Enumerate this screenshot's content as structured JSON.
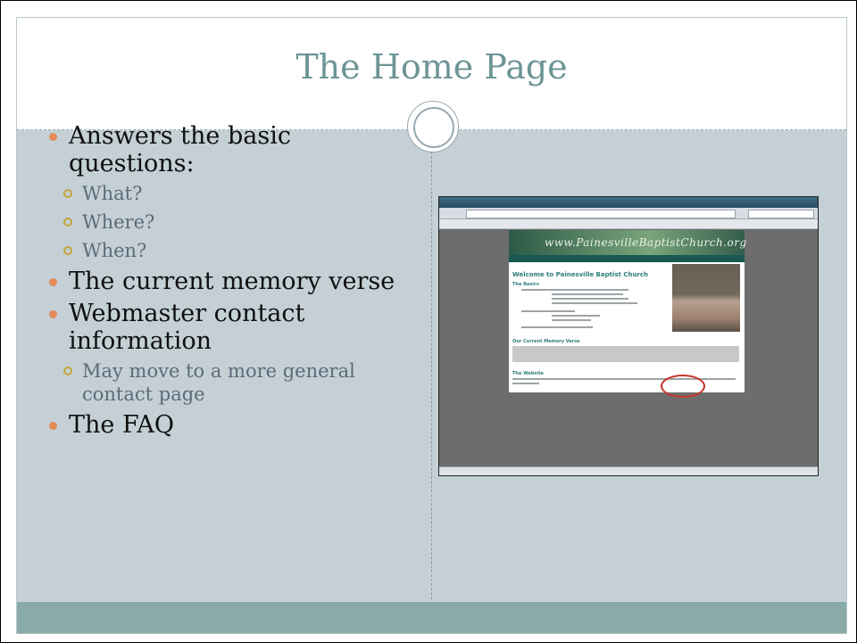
{
  "slide": {
    "title": "The Home Page",
    "bullets": [
      {
        "level": 1,
        "text": "Answers the basic questions:"
      },
      {
        "level": 2,
        "text": "What?"
      },
      {
        "level": 2,
        "text": "Where?"
      },
      {
        "level": 2,
        "text": "When?"
      },
      {
        "level": 1,
        "text": "The current memory verse"
      },
      {
        "level": 1,
        "text": "Webmaster contact information"
      },
      {
        "level": 2,
        "text": "May move to a more general contact page"
      },
      {
        "level": 1,
        "text": "The FAQ"
      }
    ]
  },
  "screenshot": {
    "site_banner": "www.PainesvilleBaptistChurch.org",
    "welcome_heading": "Welcome to Painesville Baptist Church",
    "sections": [
      "The Basics",
      "Our Current Memory Verse",
      "The Website"
    ]
  },
  "colors": {
    "title": "#6e9595",
    "panel": "#c4d0d5",
    "footer": "#89aba8",
    "bullet_level1": "#e38a58",
    "bullet_level2": "#c2a43a",
    "highlight_circle": "#c8352b"
  }
}
